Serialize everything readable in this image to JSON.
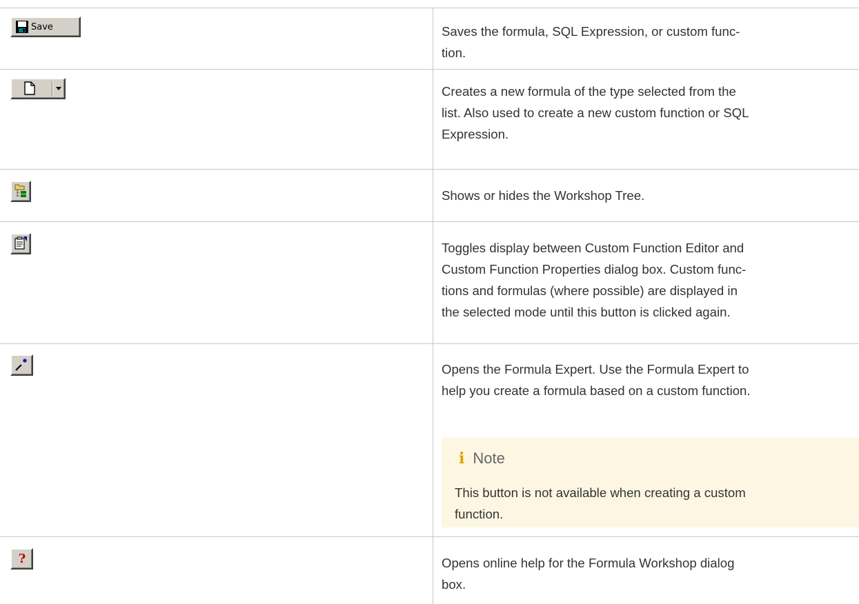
{
  "rows": [
    {
      "button": {
        "icon": "floppy-disk-icon",
        "label": "Save"
      },
      "description": [
        "Saves the formula, SQL Expression, or custom func-",
        "tion."
      ]
    },
    {
      "button": {
        "icon": "new-document-icon",
        "dropdown_icon": "dropdown-arrow-icon"
      },
      "description": [
        "Creates a new formula of the type selected from the",
        "list. Also used to create a new custom function or SQL",
        "Expression."
      ]
    },
    {
      "button": {
        "icon": "workshop-tree-icon"
      },
      "description": [
        "Shows or hides the Workshop Tree."
      ]
    },
    {
      "button": {
        "icon": "properties-toggle-icon"
      },
      "description": [
        "Toggles display between Custom Function Editor and",
        "Custom Function Properties dialog box. Custom func-",
        "tions and formulas (where possible) are displayed in",
        "the selected mode until this button is clicked again."
      ]
    },
    {
      "button": {
        "icon": "magic-wand-icon"
      },
      "description": [
        "Opens the Formula Expert. Use the Formula Expert to",
        "help you create a formula based on a custom function."
      ],
      "note": {
        "icon_glyph": "i",
        "title": "Note",
        "body": [
          "This button is not available when creating a custom",
          "function."
        ]
      }
    },
    {
      "button": {
        "icon": "help-question-icon"
      },
      "description": [
        "Opens online help for the Formula Workshop dialog",
        "box."
      ]
    }
  ],
  "colors": {
    "border": "#c8c8c8",
    "button_face": "#d4d0c8",
    "note_background": "#fdf6e3",
    "note_icon": "#e0a000",
    "text": "#333333"
  }
}
